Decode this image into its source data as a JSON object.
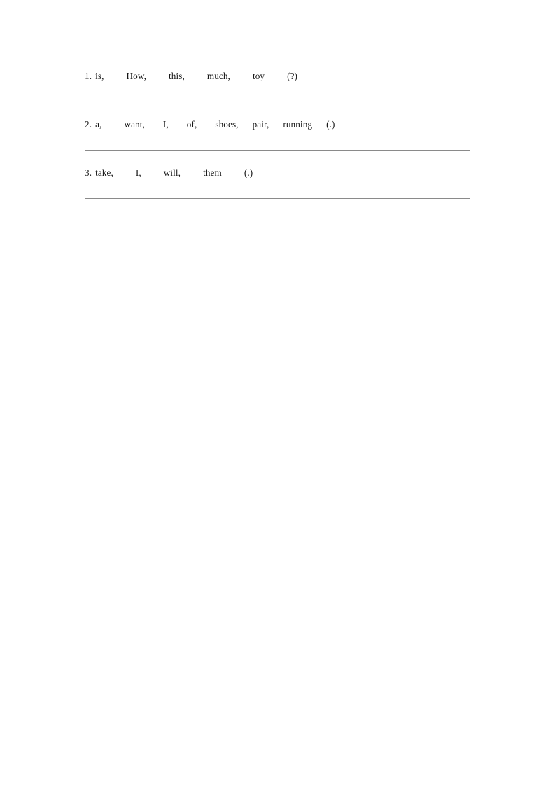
{
  "document": {
    "type": "worksheet",
    "page_background": "#ffffff",
    "text_color": "#161616",
    "rule_color": "#8a8a8a"
  },
  "exercise": {
    "items": [
      {
        "number": "1.",
        "words": [
          "is,",
          "How,",
          "this,",
          "much,",
          "toy",
          "(?)"
        ],
        "full_line": "1. is,    How,    this,    much,    toy    (?)",
        "answer_rule": true
      },
      {
        "number": "2.",
        "words": [
          "a,",
          "want,",
          "I,",
          "of,",
          "shoes,",
          "pair,",
          "running",
          "(.)"
        ],
        "full_line": "2. a,    want,    I,    of,    shoes,    pair,    running    (.)",
        "answer_rule": true
      },
      {
        "number": "3.",
        "words": [
          "take,",
          "I,",
          "will,",
          "them",
          "(.)"
        ],
        "full_line": "3. take,    I,    will,    them    (.)",
        "answer_rule": true
      }
    ]
  }
}
